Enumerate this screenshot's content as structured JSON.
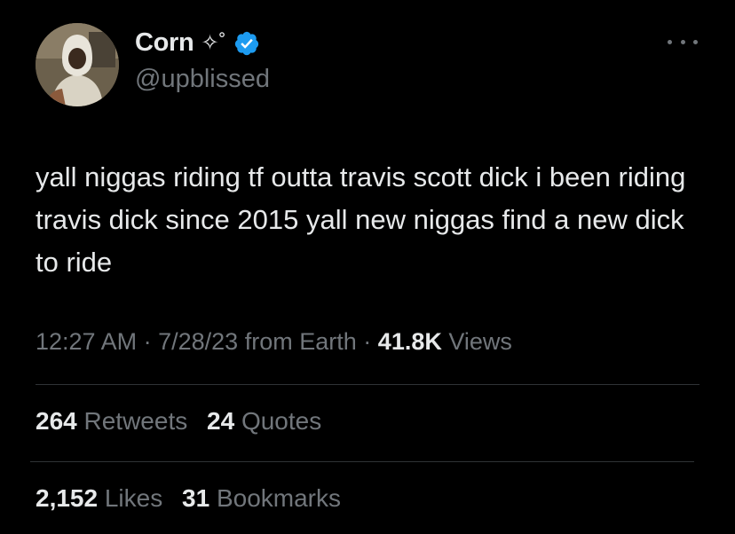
{
  "user": {
    "display_name": "Corn",
    "name_decoration": "✧˚",
    "handle": "@upblissed",
    "verified": true,
    "avatar_icon": "user-avatar"
  },
  "tweet": {
    "text": "yall niggas riding tf outta travis scott dick i been riding travis dick since 2015 yall new niggas find a new dick to ride"
  },
  "meta": {
    "time": "12:27 AM",
    "sep1": "·",
    "date": "7/28/23",
    "source": "from Earth",
    "sep2": "·",
    "views_count": "41.8K",
    "views_label": "Views"
  },
  "stats": {
    "retweets_count": "264",
    "retweets_label": "Retweets",
    "quotes_count": "24",
    "quotes_label": "Quotes",
    "likes_count": "2,152",
    "likes_label": "Likes",
    "bookmarks_count": "31",
    "bookmarks_label": "Bookmarks"
  },
  "colors": {
    "background": "#000000",
    "primary_text": "#e7e9ea",
    "secondary_text": "#71767b",
    "verified_blue": "#1d9bf0",
    "divider": "#2f3336"
  }
}
